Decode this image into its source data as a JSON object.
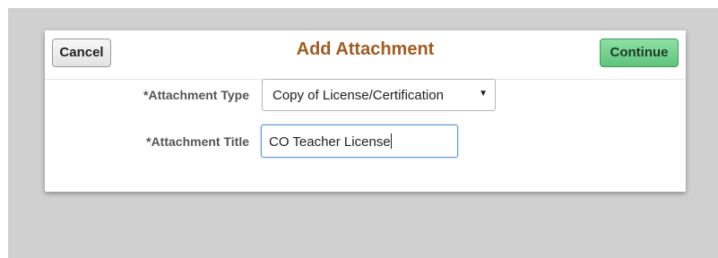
{
  "dialog": {
    "title": "Add Attachment",
    "cancel_label": "Cancel",
    "continue_label": "Continue",
    "continue_color": "#5fc47c",
    "title_color": "#a15c1e"
  },
  "form": {
    "attachment_type": {
      "label": "*Attachment Type",
      "selected_value": "Copy of License/Certification",
      "arrow_icon": "dropdown-arrow-icon"
    },
    "attachment_title": {
      "label": "*Attachment Title",
      "value": "CO Teacher License"
    }
  }
}
